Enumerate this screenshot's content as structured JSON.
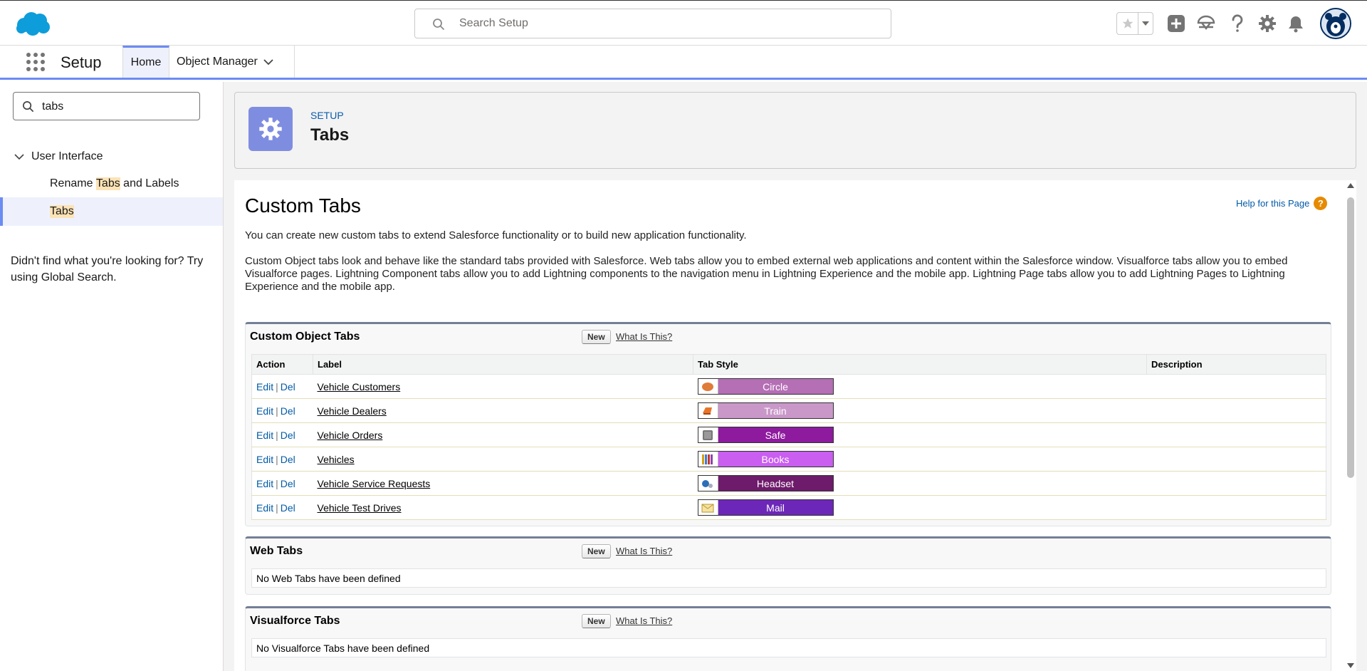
{
  "header": {
    "search_placeholder": "Search Setup"
  },
  "context_bar": {
    "app_name": "Setup",
    "tabs": [
      {
        "label": "Home"
      },
      {
        "label": "Object Manager"
      }
    ]
  },
  "sidebar": {
    "quickfind_value": "tabs",
    "group_label": "User Interface",
    "items": [
      {
        "pre": "Rename ",
        "highlight": "Tabs",
        "post": " and Labels"
      },
      {
        "pre": "",
        "highlight": "Tabs",
        "post": ""
      }
    ],
    "not_found": "Didn't find what you're looking for? Try using Global Search."
  },
  "page_header": {
    "section": "SETUP",
    "title": "Tabs"
  },
  "content": {
    "title": "Custom Tabs",
    "help_link": "Help for this Page",
    "help_icon": "?",
    "intro": "You can create new custom tabs to extend Salesforce functionality or to build new application functionality.",
    "description": "Custom Object tabs look and behave like the standard tabs provided with Salesforce. Web tabs allow you to embed external web applications and content within the Salesforce window. Visualforce tabs allow you to embed Visualforce pages. Lightning Component tabs allow you to add Lightning components to the navigation menu in Lightning Experience and the mobile app. Lightning Page tabs allow you to add Lightning Pages to Lightning Experience and the mobile app.",
    "custom_object_tabs": {
      "title": "Custom Object Tabs",
      "new_label": "New",
      "what_label": "What Is This?",
      "columns": [
        "Action",
        "Label",
        "Tab Style",
        "Description"
      ],
      "edit_label": "Edit",
      "del_label": "Del",
      "sep": "|",
      "rows": [
        {
          "label": "Vehicle Customers",
          "style": "Circle",
          "color": "#b56fb5",
          "icon": "circle-icon",
          "description": ""
        },
        {
          "label": "Vehicle Dealers",
          "style": "Train",
          "color": "#c998c9",
          "icon": "train-icon",
          "description": ""
        },
        {
          "label": "Vehicle Orders",
          "style": "Safe",
          "color": "#8e1a9e",
          "icon": "safe-icon",
          "description": ""
        },
        {
          "label": "Vehicles",
          "style": "Books",
          "color": "#c95ef0",
          "icon": "books-icon",
          "description": ""
        },
        {
          "label": "Vehicle Service Requests",
          "style": "Headset",
          "color": "#6e1b6b",
          "icon": "headset-icon",
          "description": ""
        },
        {
          "label": "Vehicle Test Drives",
          "style": "Mail",
          "color": "#6d27b8",
          "icon": "mail-icon",
          "description": ""
        }
      ]
    },
    "web_tabs": {
      "title": "Web Tabs",
      "new_label": "New",
      "what_label": "What Is This?",
      "empty": "No Web Tabs have been defined"
    },
    "visualforce_tabs": {
      "title": "Visualforce Tabs",
      "new_label": "New",
      "what_label": "What Is This?",
      "empty": "No Visualforce Tabs have been defined"
    }
  },
  "colors": {
    "brand": "#0176d3",
    "accent": "#6c8bf3",
    "setup_icon_bg": "#7f8de1",
    "link": "#015ba7"
  }
}
